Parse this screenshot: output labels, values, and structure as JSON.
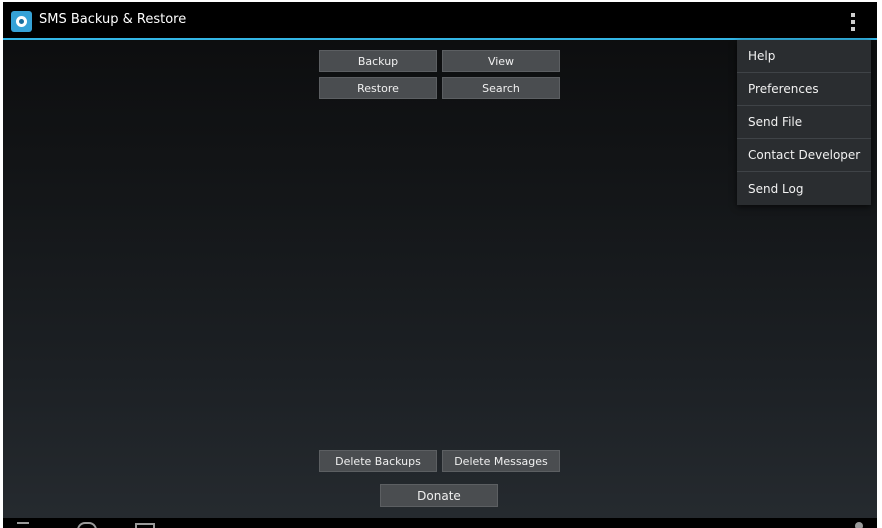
{
  "app": {
    "title": "SMS Backup & Restore",
    "icon": "app-logo-icon",
    "accent_color": "#33b5e5"
  },
  "actionbar": {
    "overflow_icon": "overflow-menu-icon"
  },
  "main": {
    "buttons": {
      "backup": "Backup",
      "view": "View",
      "restore": "Restore",
      "search": "Search",
      "delete_backups": "Delete Backups",
      "delete_messages": "Delete Messages",
      "donate": "Donate"
    }
  },
  "overflow_menu": {
    "items": [
      {
        "label": "Help"
      },
      {
        "label": "Preferences"
      },
      {
        "label": "Send File"
      },
      {
        "label": "Contact Developer"
      },
      {
        "label": "Send Log"
      }
    ]
  },
  "navbar": {
    "icons": [
      "back-icon",
      "home-icon",
      "recent-apps-icon"
    ]
  }
}
